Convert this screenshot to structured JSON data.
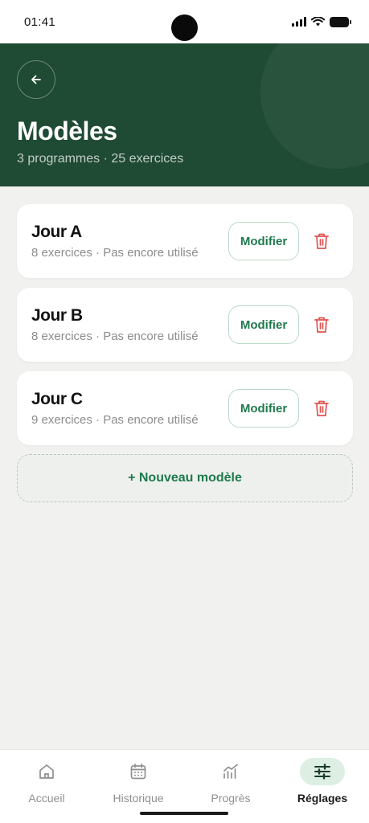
{
  "status_bar": {
    "time": "01:41"
  },
  "header": {
    "title": "Modèles",
    "subtitle": "3 programmes · 25 exercices"
  },
  "templates": [
    {
      "name": "Jour A",
      "meta": "8 exercices · Pas encore utilisé",
      "edit_label": "Modifier"
    },
    {
      "name": "Jour B",
      "meta": "8 exercices · Pas encore utilisé",
      "edit_label": "Modifier"
    },
    {
      "name": "Jour C",
      "meta": "9 exercices · Pas encore utilisé",
      "edit_label": "Modifier"
    }
  ],
  "new_template_label": "+ Nouveau modèle",
  "bottom_nav": {
    "items": [
      {
        "label": "Accueil",
        "icon": "home-icon"
      },
      {
        "label": "Historique",
        "icon": "calendar-icon"
      },
      {
        "label": "Progrès",
        "icon": "chart-icon"
      },
      {
        "label": "Réglages",
        "icon": "sliders-icon",
        "active": true
      }
    ]
  },
  "colors": {
    "header_bg": "#1f4a33",
    "accent": "#1f7a4d",
    "danger": "#e0524f"
  }
}
